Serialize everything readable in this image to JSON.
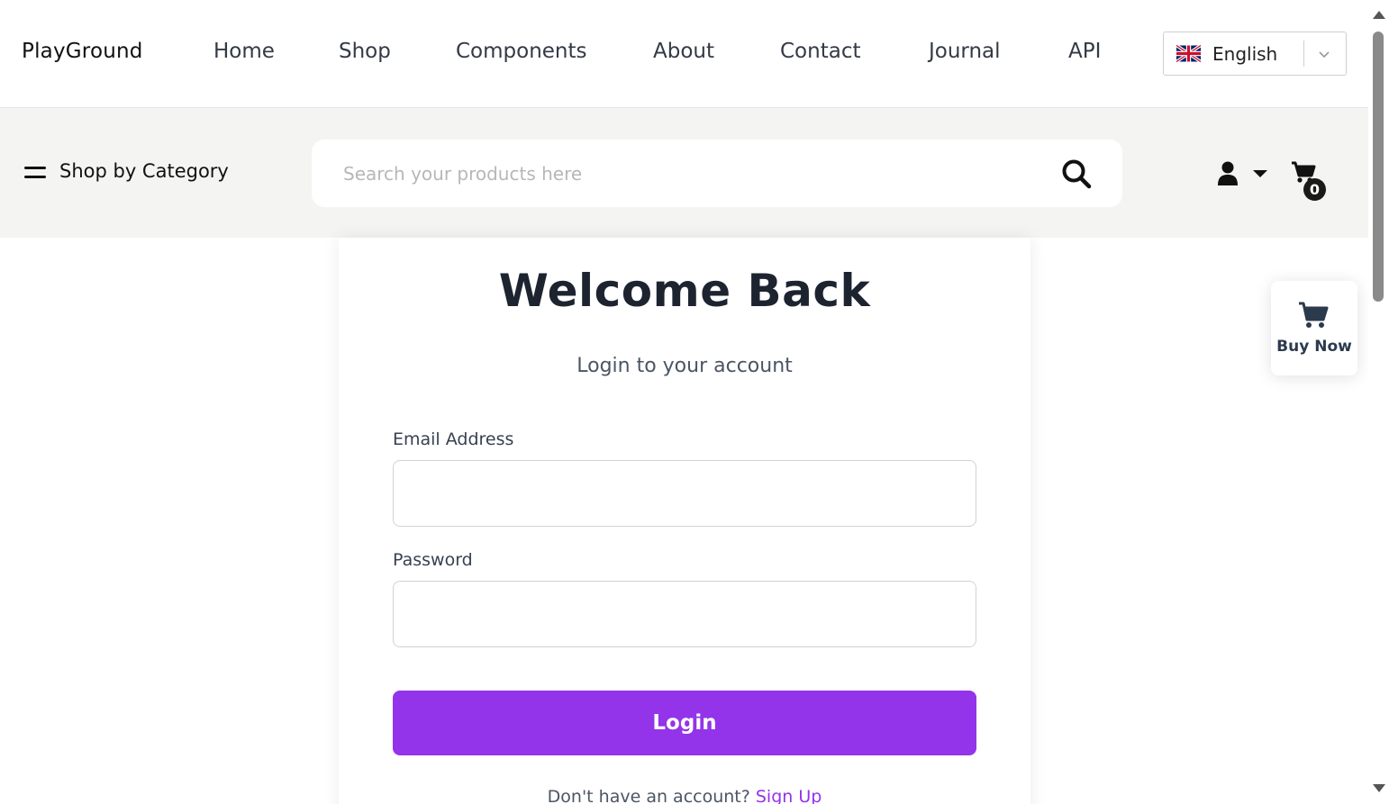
{
  "brand": "PlayGround",
  "nav": {
    "links": [
      "Home",
      "Shop",
      "Components",
      "About",
      "Contact",
      "Journal",
      "API"
    ]
  },
  "language": {
    "selected": "English",
    "flag_icon": "uk-flag-icon",
    "chevron_icon": "chevron-down-icon"
  },
  "subbar": {
    "category_label": "Shop by Category",
    "category_icon": "hamburger-menu-icon",
    "search_placeholder": "Search your products here",
    "search_icon": "search-icon",
    "user_icon": "user-icon",
    "cart_icon": "cart-icon",
    "cart_count": "0"
  },
  "login": {
    "title": "Welcome Back",
    "subtitle": "Login to your account",
    "email_label": "Email Address",
    "email_value": "",
    "password_label": "Password",
    "password_value": "",
    "button_label": "Login",
    "signup_prompt": "Don't have an account?",
    "signup_link": "Sign Up"
  },
  "floating": {
    "buy_now_label": "Buy Now",
    "buy_now_icon": "shopping-cart-icon"
  },
  "colors": {
    "accent": "#9333ea",
    "subbar_bg": "#f4f4f2",
    "heading": "#1d2430"
  }
}
